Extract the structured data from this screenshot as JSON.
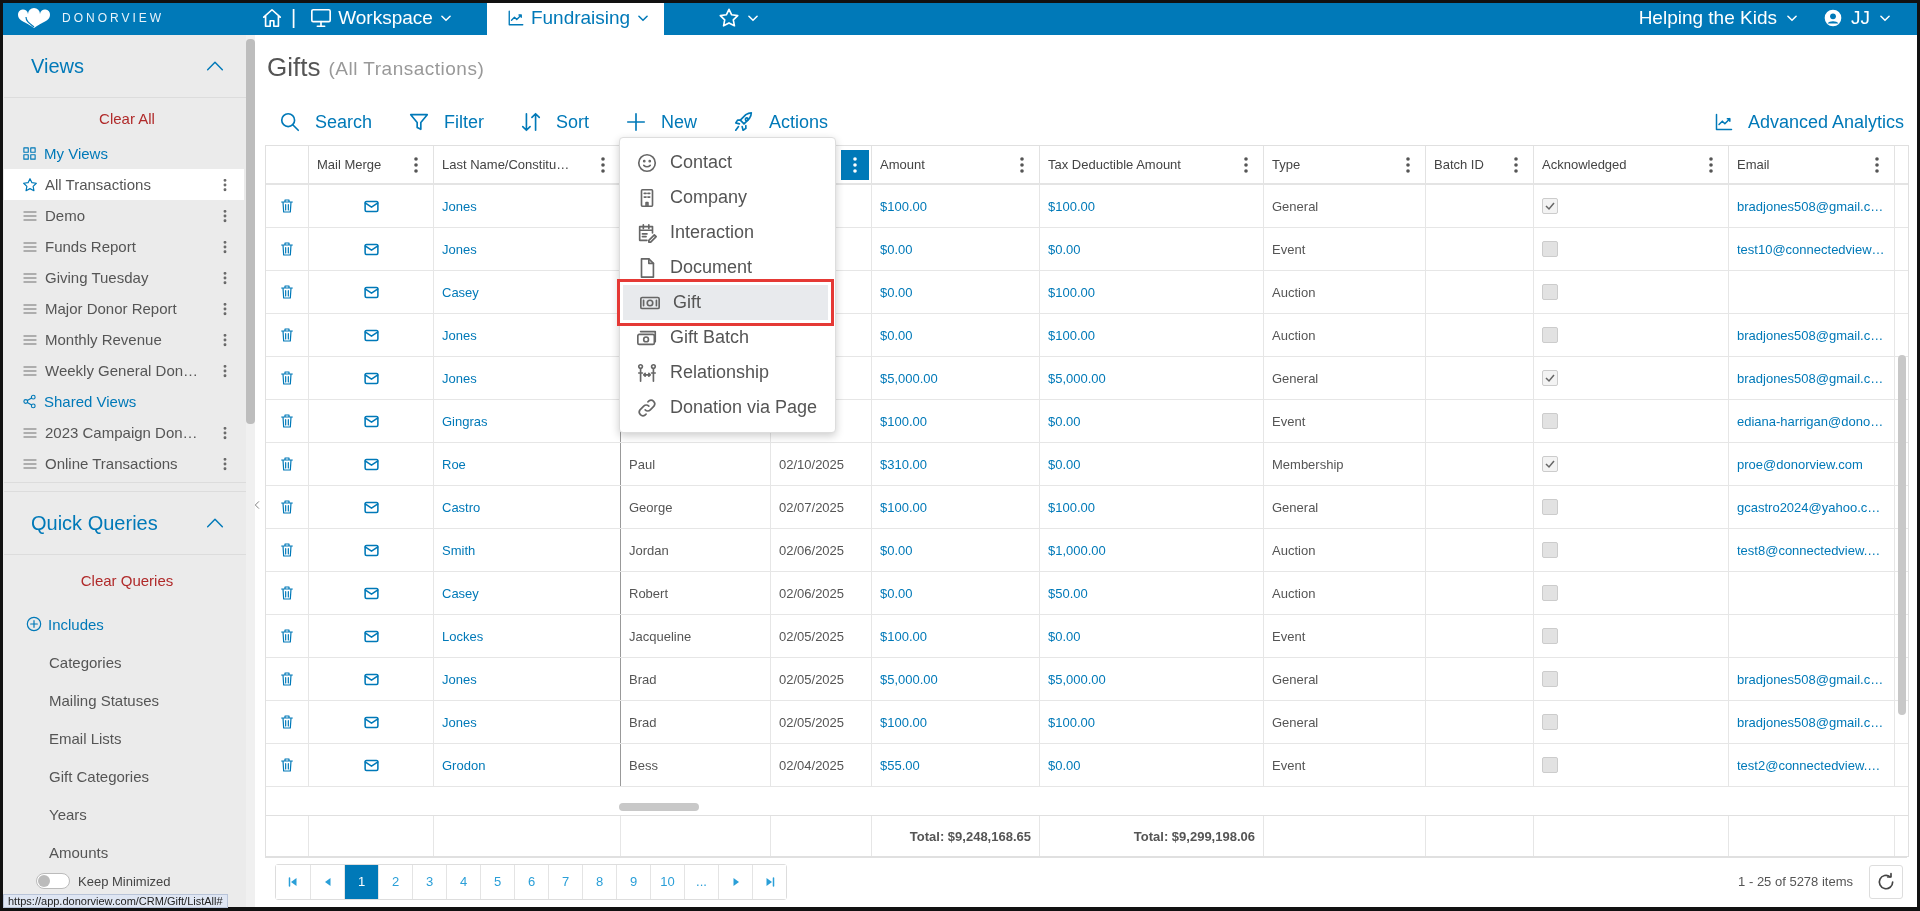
{
  "nav": {
    "logo": "DONORVIEW",
    "separator": "|",
    "menus": [
      {
        "kind": "workspace",
        "label": "Workspace",
        "selected": false
      },
      {
        "kind": "fundraising",
        "label": "Fundraising",
        "selected": true
      },
      {
        "kind": "favorites",
        "selected": false
      }
    ],
    "organization": "Helping the Kids",
    "user": "JJ"
  },
  "sidebar": {
    "views": {
      "title": "Views",
      "expanded": true,
      "clear": "Clear All",
      "items": [
        {
          "kind": "my_views",
          "label": "My Views"
        },
        {
          "kind": "view",
          "label": "All Transactions",
          "selected": true,
          "starred": true
        },
        {
          "kind": "view",
          "label": "Demo",
          "selected": false,
          "starred": false
        },
        {
          "kind": "view",
          "label": "Funds Report",
          "selected": false,
          "starred": false
        },
        {
          "kind": "view",
          "label": "Giving Tuesday",
          "selected": false,
          "starred": false
        },
        {
          "kind": "view",
          "label": "Major Donor Report",
          "selected": false,
          "starred": false
        },
        {
          "kind": "view",
          "label": "Monthly Revenue",
          "selected": false,
          "starred": false
        },
        {
          "kind": "view",
          "label": "Weekly General Don…",
          "selected": false,
          "starred": false
        },
        {
          "kind": "shared_views",
          "label": "Shared Views"
        },
        {
          "kind": "view",
          "label": "2023 Campaign Don…",
          "selected": false,
          "starred": false
        },
        {
          "kind": "view",
          "label": "Online Transactions",
          "selected": false,
          "starred": false
        }
      ]
    },
    "queries": {
      "title": "Quick Queries",
      "expanded": true,
      "clear": "Clear Queries",
      "includes": "Includes",
      "items": [
        "Categories",
        "Mailing Statuses",
        "Email Lists",
        "Gift Categories",
        "Years",
        "Amounts"
      ]
    },
    "keep_minimized": {
      "label": "Keep Minimized",
      "on": false
    }
  },
  "page": {
    "title": "Gifts",
    "subtitle": "(All Transactions)"
  },
  "toolbar": {
    "actions": [
      {
        "kind": "search",
        "label": "Search"
      },
      {
        "kind": "filter",
        "label": "Filter"
      },
      {
        "kind": "sort",
        "label": "Sort"
      },
      {
        "kind": "new",
        "label": "New"
      },
      {
        "kind": "actions",
        "label": "Actions"
      }
    ],
    "analytics": "Advanced Analytics"
  },
  "new_menu": {
    "items": [
      {
        "kind": "contact",
        "label": "Contact",
        "selected": false
      },
      {
        "kind": "company",
        "label": "Company",
        "selected": false
      },
      {
        "kind": "interaction",
        "label": "Interaction",
        "selected": false
      },
      {
        "kind": "document",
        "label": "Document",
        "selected": false
      },
      {
        "kind": "gift",
        "label": "Gift",
        "selected": true
      },
      {
        "kind": "gift_batch",
        "label": "Gift Batch",
        "selected": false
      },
      {
        "kind": "relationship",
        "label": "Relationship",
        "selected": false
      },
      {
        "kind": "donation_page",
        "label": "Donation via Page",
        "selected": false
      }
    ]
  },
  "table": {
    "columns": [
      {
        "kind": "delete"
      },
      {
        "kind": "data",
        "label": "Mail Merge",
        "menu_active": false
      },
      {
        "kind": "data",
        "label": "Last Name/Constitu…",
        "menu_active": false
      },
      {
        "kind": "covered"
      },
      {
        "kind": "data",
        "menu_active": true
      },
      {
        "kind": "data",
        "label": "Amount",
        "menu_active": false
      },
      {
        "kind": "data",
        "label": "Tax Deductible Amount",
        "menu_active": false
      },
      {
        "kind": "data",
        "label": "Type",
        "menu_active": false
      },
      {
        "kind": "data",
        "label": "Batch ID",
        "menu_active": false
      },
      {
        "kind": "data",
        "label": "Acknowledged",
        "menu_active": false
      },
      {
        "kind": "data",
        "label": "Email",
        "menu_active": false
      }
    ],
    "rows": [
      {
        "last_name": "Jones",
        "amount": "$100.00",
        "tax_deductible": "$100.00",
        "type": "General",
        "acknowledged": true,
        "email": "bradjones508@gmail.c…"
      },
      {
        "last_name": "Jones",
        "amount": "$0.00",
        "tax_deductible": "$0.00",
        "type": "Event",
        "acknowledged": false,
        "email": "test10@connectedview…"
      },
      {
        "last_name": "Casey",
        "amount": "$0.00",
        "tax_deductible": "$100.00",
        "type": "Auction",
        "acknowledged": false
      },
      {
        "last_name": "Jones",
        "amount": "$0.00",
        "tax_deductible": "$100.00",
        "type": "Auction",
        "acknowledged": false,
        "email": "bradjones508@gmail.c…"
      },
      {
        "last_name": "Jones",
        "amount": "$5,000.00",
        "tax_deductible": "$5,000.00",
        "type": "General",
        "acknowledged": true,
        "email": "bradjones508@gmail.c…"
      },
      {
        "last_name": "Gingras",
        "amount": "$100.00",
        "tax_deductible": "$0.00",
        "type": "Event",
        "acknowledged": false,
        "email": "ediana-harrigan@dono…"
      },
      {
        "last_name": "Roe",
        "first_name": "Paul",
        "date": "02/10/2025",
        "amount": "$310.00",
        "tax_deductible": "$0.00",
        "type": "Membership",
        "acknowledged": true,
        "email": "proe@donorview.com"
      },
      {
        "last_name": "Castro",
        "first_name": "George",
        "date": "02/07/2025",
        "amount": "$100.00",
        "tax_deductible": "$100.00",
        "type": "General",
        "acknowledged": false,
        "email": "gcastro2024@yahoo.c…"
      },
      {
        "last_name": "Smith",
        "first_name": "Jordan",
        "date": "02/06/2025",
        "amount": "$0.00",
        "tax_deductible": "$1,000.00",
        "type": "Auction",
        "acknowledged": false,
        "email": "test8@connectedview.…"
      },
      {
        "last_name": "Casey",
        "first_name": "Robert",
        "date": "02/06/2025",
        "amount": "$0.00",
        "tax_deductible": "$50.00",
        "type": "Auction",
        "acknowledged": false
      },
      {
        "last_name": "Lockes",
        "first_name": "Jacqueline",
        "date": "02/05/2025",
        "amount": "$100.00",
        "tax_deductible": "$0.00",
        "type": "Event",
        "acknowledged": false
      },
      {
        "last_name": "Jones",
        "first_name": "Brad",
        "date": "02/05/2025",
        "amount": "$5,000.00",
        "tax_deductible": "$5,000.00",
        "type": "General",
        "acknowledged": false,
        "email": "bradjones508@gmail.c…"
      },
      {
        "last_name": "Jones",
        "first_name": "Brad",
        "date": "02/05/2025",
        "amount": "$100.00",
        "tax_deductible": "$100.00",
        "type": "General",
        "acknowledged": false,
        "email": "bradjones508@gmail.c…"
      },
      {
        "last_name": "Grodon",
        "first_name": "Bess",
        "date": "02/04/2025",
        "amount": "$55.00",
        "tax_deductible": "$0.00",
        "type": "Event",
        "acknowledged": false,
        "email": "test2@connectedview.…"
      }
    ],
    "totals": {
      "amount": "Total: $9,248,168.65",
      "tax_deductible": "Total: $9,299,198.06"
    }
  },
  "pagination": {
    "pages": [
      {
        "label": "1",
        "selected": true
      },
      {
        "label": "2",
        "selected": false
      },
      {
        "label": "3",
        "selected": false
      },
      {
        "label": "4",
        "selected": false
      },
      {
        "label": "5",
        "selected": false
      },
      {
        "label": "6",
        "selected": false
      },
      {
        "label": "7",
        "selected": false
      },
      {
        "label": "8",
        "selected": false
      },
      {
        "label": "9",
        "selected": false
      },
      {
        "label": "10",
        "selected": false
      },
      {
        "label": "...",
        "selected": false
      }
    ],
    "summary": "1 - 25 of 5278 items"
  },
  "status_url": "https://app.donorview.com/CRM/Gift/ListAll#"
}
